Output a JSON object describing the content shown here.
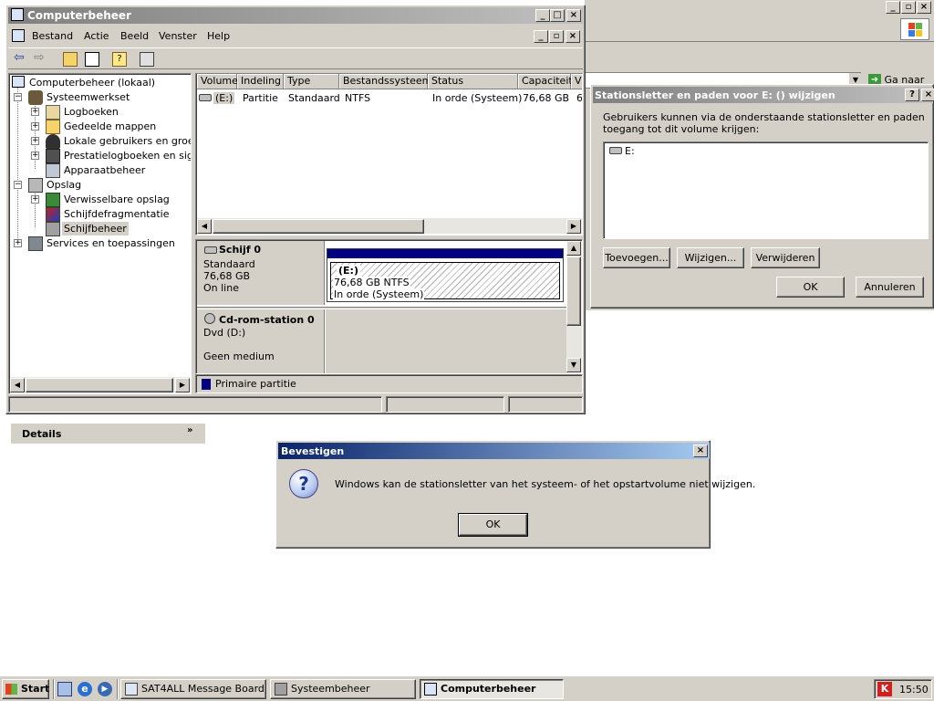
{
  "colors": {
    "titlebar_inactive": "#808080",
    "titlebar_active": "#0a246a",
    "window_face": "#d4d0c8",
    "desktop": "#ffffff",
    "primary_partition": "#000080"
  },
  "bg_window": {
    "goto_label": "Ga naar"
  },
  "main_window": {
    "title": "Computerbeheer",
    "menu": [
      "Bestand",
      "Actie",
      "Beeld",
      "Venster",
      "Help"
    ],
    "tree": [
      {
        "label": "Computerbeheer (lokaal)",
        "icon": "computer-icon"
      },
      {
        "label": "Systeemwerkset",
        "icon": "tools-icon"
      },
      {
        "label": "Logboeken",
        "icon": "event-log-icon"
      },
      {
        "label": "Gedeelde mappen",
        "icon": "shared-folder-icon"
      },
      {
        "label": "Lokale gebruikers en groepen",
        "icon": "users-icon"
      },
      {
        "label": "Prestatielogboeken en signalen",
        "icon": "performance-icon"
      },
      {
        "label": "Apparaatbeheer",
        "icon": "device-manager-icon"
      },
      {
        "label": "Opslag",
        "icon": "storage-icon"
      },
      {
        "label": "Verwisselbare opslag",
        "icon": "removable-storage-icon"
      },
      {
        "label": "Schijfdefragmentatie",
        "icon": "defrag-icon"
      },
      {
        "label": "Schijfbeheer",
        "icon": "disk-management-icon"
      },
      {
        "label": "Services en toepassingen",
        "icon": "services-icon"
      }
    ],
    "columns": [
      "Volume",
      "Indeling",
      "Type",
      "Bestandssysteem",
      "Status",
      "Capaciteit",
      "V"
    ],
    "volume_row": {
      "volume": "(E:)",
      "layout": "Partitie",
      "type": "Standaard",
      "fs": "NTFS",
      "status": "In orde (Systeem)",
      "capacity": "76,68 GB",
      "extra": "6"
    },
    "disk0": {
      "name": "Schijf 0",
      "type": "Standaard",
      "size": "76,68 GB",
      "state": "On line",
      "part_name": "(E:)",
      "part_size": "76,68 GB NTFS",
      "part_status": "In orde (Systeem)"
    },
    "cdrom": {
      "name": "Cd-rom-station 0",
      "drive": "Dvd (D:)",
      "media": "Geen medium"
    },
    "legend": "Primaire partitie"
  },
  "details_panel": {
    "title": "Details"
  },
  "letter_dialog": {
    "title": "Stationsletter en paden voor E: () wijzigen",
    "desc": "Gebruikers kunnen via de onderstaande stationsletter en paden toegang tot dit volume krijgen:",
    "entry": "E:",
    "add": "Toevoegen...",
    "change": "Wijzigen...",
    "remove": "Verwijderen",
    "ok": "OK",
    "cancel": "Annuleren"
  },
  "confirm_dialog": {
    "title": "Bevestigen",
    "message": "Windows kan de stationsletter van het systeem- of het opstartvolume niet wijzigen.",
    "ok": "OK"
  },
  "taskbar": {
    "start": "Start",
    "tasks": [
      "SAT4ALL Message Board...",
      "Systeembeheer",
      "Computerbeheer"
    ],
    "clock": "15:50"
  }
}
